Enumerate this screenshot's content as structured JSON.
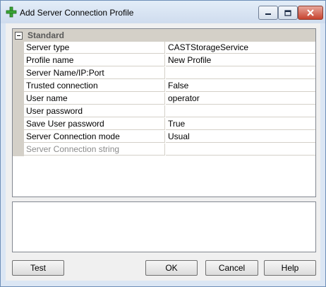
{
  "window": {
    "title": "Add Server Connection Profile",
    "icon": "green-plus-icon"
  },
  "property_grid": {
    "category": "Standard",
    "rows": [
      {
        "name": "Server type",
        "value": "CASTStorageService",
        "disabled": false
      },
      {
        "name": "Profile name",
        "value": "New Profile",
        "disabled": false
      },
      {
        "name": "Server Name/IP:Port",
        "value": "",
        "disabled": false
      },
      {
        "name": "Trusted connection",
        "value": "False",
        "disabled": false
      },
      {
        "name": "User name",
        "value": "operator",
        "disabled": false
      },
      {
        "name": "User password",
        "value": "",
        "disabled": false
      },
      {
        "name": "Save User password",
        "value": "True",
        "disabled": false
      },
      {
        "name": "Server Connection mode",
        "value": "Usual",
        "disabled": false
      },
      {
        "name": "Server Connection string",
        "value": "",
        "disabled": true
      }
    ]
  },
  "buttons": {
    "test": "Test",
    "ok": "OK",
    "cancel": "Cancel",
    "help": "Help"
  },
  "colors": {
    "titlebar": "#cfdcee",
    "category_band": "#d4d0c8",
    "close_button": "#c7432f"
  }
}
